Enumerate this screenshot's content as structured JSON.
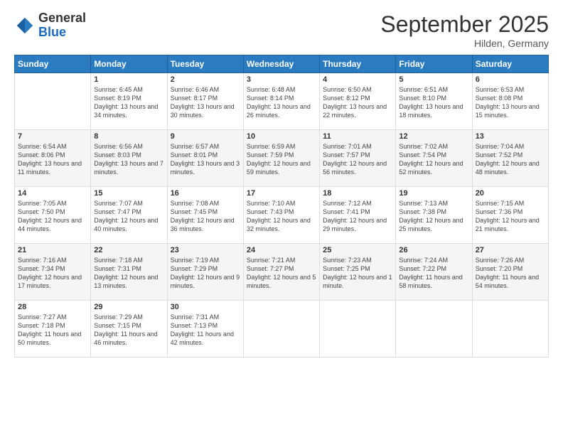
{
  "logo": {
    "general": "General",
    "blue": "Blue"
  },
  "title": {
    "month": "September 2025",
    "location": "Hilden, Germany"
  },
  "days_header": [
    "Sunday",
    "Monday",
    "Tuesday",
    "Wednesday",
    "Thursday",
    "Friday",
    "Saturday"
  ],
  "weeks": [
    [
      {
        "day": "",
        "sunrise": "",
        "sunset": "",
        "daylight": ""
      },
      {
        "day": "1",
        "sunrise": "Sunrise: 6:45 AM",
        "sunset": "Sunset: 8:19 PM",
        "daylight": "Daylight: 13 hours and 34 minutes."
      },
      {
        "day": "2",
        "sunrise": "Sunrise: 6:46 AM",
        "sunset": "Sunset: 8:17 PM",
        "daylight": "Daylight: 13 hours and 30 minutes."
      },
      {
        "day": "3",
        "sunrise": "Sunrise: 6:48 AM",
        "sunset": "Sunset: 8:14 PM",
        "daylight": "Daylight: 13 hours and 26 minutes."
      },
      {
        "day": "4",
        "sunrise": "Sunrise: 6:50 AM",
        "sunset": "Sunset: 8:12 PM",
        "daylight": "Daylight: 13 hours and 22 minutes."
      },
      {
        "day": "5",
        "sunrise": "Sunrise: 6:51 AM",
        "sunset": "Sunset: 8:10 PM",
        "daylight": "Daylight: 13 hours and 18 minutes."
      },
      {
        "day": "6",
        "sunrise": "Sunrise: 6:53 AM",
        "sunset": "Sunset: 8:08 PM",
        "daylight": "Daylight: 13 hours and 15 minutes."
      }
    ],
    [
      {
        "day": "7",
        "sunrise": "Sunrise: 6:54 AM",
        "sunset": "Sunset: 8:06 PM",
        "daylight": "Daylight: 13 hours and 11 minutes."
      },
      {
        "day": "8",
        "sunrise": "Sunrise: 6:56 AM",
        "sunset": "Sunset: 8:03 PM",
        "daylight": "Daylight: 13 hours and 7 minutes."
      },
      {
        "day": "9",
        "sunrise": "Sunrise: 6:57 AM",
        "sunset": "Sunset: 8:01 PM",
        "daylight": "Daylight: 13 hours and 3 minutes."
      },
      {
        "day": "10",
        "sunrise": "Sunrise: 6:59 AM",
        "sunset": "Sunset: 7:59 PM",
        "daylight": "Daylight: 12 hours and 59 minutes."
      },
      {
        "day": "11",
        "sunrise": "Sunrise: 7:01 AM",
        "sunset": "Sunset: 7:57 PM",
        "daylight": "Daylight: 12 hours and 56 minutes."
      },
      {
        "day": "12",
        "sunrise": "Sunrise: 7:02 AM",
        "sunset": "Sunset: 7:54 PM",
        "daylight": "Daylight: 12 hours and 52 minutes."
      },
      {
        "day": "13",
        "sunrise": "Sunrise: 7:04 AM",
        "sunset": "Sunset: 7:52 PM",
        "daylight": "Daylight: 12 hours and 48 minutes."
      }
    ],
    [
      {
        "day": "14",
        "sunrise": "Sunrise: 7:05 AM",
        "sunset": "Sunset: 7:50 PM",
        "daylight": "Daylight: 12 hours and 44 minutes."
      },
      {
        "day": "15",
        "sunrise": "Sunrise: 7:07 AM",
        "sunset": "Sunset: 7:47 PM",
        "daylight": "Daylight: 12 hours and 40 minutes."
      },
      {
        "day": "16",
        "sunrise": "Sunrise: 7:08 AM",
        "sunset": "Sunset: 7:45 PM",
        "daylight": "Daylight: 12 hours and 36 minutes."
      },
      {
        "day": "17",
        "sunrise": "Sunrise: 7:10 AM",
        "sunset": "Sunset: 7:43 PM",
        "daylight": "Daylight: 12 hours and 32 minutes."
      },
      {
        "day": "18",
        "sunrise": "Sunrise: 7:12 AM",
        "sunset": "Sunset: 7:41 PM",
        "daylight": "Daylight: 12 hours and 29 minutes."
      },
      {
        "day": "19",
        "sunrise": "Sunrise: 7:13 AM",
        "sunset": "Sunset: 7:38 PM",
        "daylight": "Daylight: 12 hours and 25 minutes."
      },
      {
        "day": "20",
        "sunrise": "Sunrise: 7:15 AM",
        "sunset": "Sunset: 7:36 PM",
        "daylight": "Daylight: 12 hours and 21 minutes."
      }
    ],
    [
      {
        "day": "21",
        "sunrise": "Sunrise: 7:16 AM",
        "sunset": "Sunset: 7:34 PM",
        "daylight": "Daylight: 12 hours and 17 minutes."
      },
      {
        "day": "22",
        "sunrise": "Sunrise: 7:18 AM",
        "sunset": "Sunset: 7:31 PM",
        "daylight": "Daylight: 12 hours and 13 minutes."
      },
      {
        "day": "23",
        "sunrise": "Sunrise: 7:19 AM",
        "sunset": "Sunset: 7:29 PM",
        "daylight": "Daylight: 12 hours and 9 minutes."
      },
      {
        "day": "24",
        "sunrise": "Sunrise: 7:21 AM",
        "sunset": "Sunset: 7:27 PM",
        "daylight": "Daylight: 12 hours and 5 minutes."
      },
      {
        "day": "25",
        "sunrise": "Sunrise: 7:23 AM",
        "sunset": "Sunset: 7:25 PM",
        "daylight": "Daylight: 12 hours and 1 minute."
      },
      {
        "day": "26",
        "sunrise": "Sunrise: 7:24 AM",
        "sunset": "Sunset: 7:22 PM",
        "daylight": "Daylight: 11 hours and 58 minutes."
      },
      {
        "day": "27",
        "sunrise": "Sunrise: 7:26 AM",
        "sunset": "Sunset: 7:20 PM",
        "daylight": "Daylight: 11 hours and 54 minutes."
      }
    ],
    [
      {
        "day": "28",
        "sunrise": "Sunrise: 7:27 AM",
        "sunset": "Sunset: 7:18 PM",
        "daylight": "Daylight: 11 hours and 50 minutes."
      },
      {
        "day": "29",
        "sunrise": "Sunrise: 7:29 AM",
        "sunset": "Sunset: 7:15 PM",
        "daylight": "Daylight: 11 hours and 46 minutes."
      },
      {
        "day": "30",
        "sunrise": "Sunrise: 7:31 AM",
        "sunset": "Sunset: 7:13 PM",
        "daylight": "Daylight: 11 hours and 42 minutes."
      },
      {
        "day": "",
        "sunrise": "",
        "sunset": "",
        "daylight": ""
      },
      {
        "day": "",
        "sunrise": "",
        "sunset": "",
        "daylight": ""
      },
      {
        "day": "",
        "sunrise": "",
        "sunset": "",
        "daylight": ""
      },
      {
        "day": "",
        "sunrise": "",
        "sunset": "",
        "daylight": ""
      }
    ]
  ]
}
